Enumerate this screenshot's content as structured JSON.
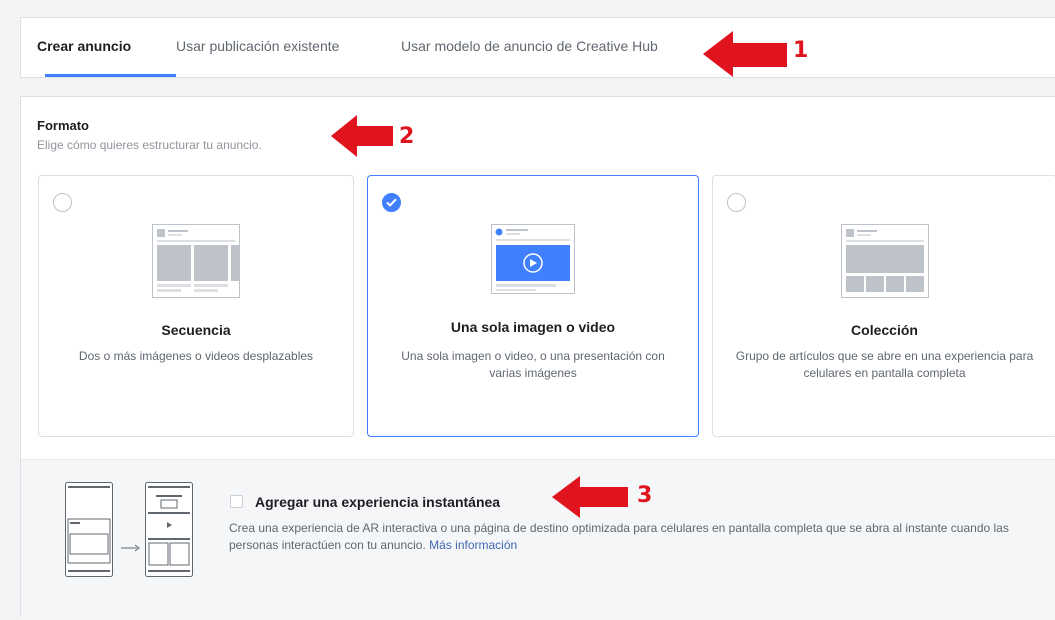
{
  "tabs": [
    {
      "label": "Crear anuncio",
      "active": true
    },
    {
      "label": "Usar publicación existente",
      "active": false
    },
    {
      "label": "Usar modelo de anuncio de Creative Hub",
      "active": false
    }
  ],
  "format": {
    "title": "Formato",
    "subtitle": "Elige cómo quieres estructurar tu anuncio."
  },
  "options": [
    {
      "title": "Secuencia",
      "description": "Dos o más imágenes o videos desplazables",
      "selected": false
    },
    {
      "title": "Una sola imagen o video",
      "description": "Una sola imagen o video, o una presentación con varias imágenes",
      "selected": true
    },
    {
      "title": "Colección",
      "description": "Grupo de artículos que se abre en una experiencia para celulares en pantalla completa",
      "selected": false
    }
  ],
  "instant": {
    "title": "Agregar una experiencia instantánea",
    "description": "Crea una experiencia de AR interactiva o una página de destino optimizada para celulares en pantalla completa que se abra al instante cuando las personas interactúen con tu anuncio.",
    "link": "Más información",
    "checked": false
  },
  "annotations": [
    "1",
    "2",
    "3"
  ],
  "colors": {
    "accent": "#4080ff",
    "link": "#4267b2",
    "annotation_red": "#e0141e"
  }
}
